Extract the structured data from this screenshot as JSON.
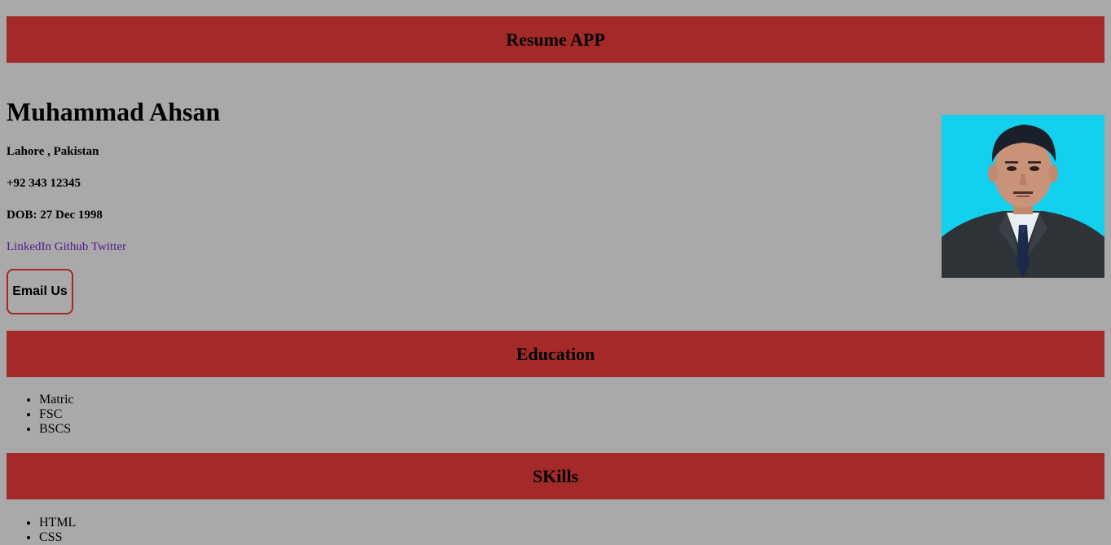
{
  "header": {
    "title": "Resume APP"
  },
  "profile": {
    "name": "Muhammad Ahsan",
    "location": "Lahore , Pakistan",
    "phone": "+92 343 12345",
    "dob": "DOB: 27 Dec 1998",
    "links": [
      "LinkedIn",
      "Github",
      "Twitter"
    ],
    "email_button": "Email Us",
    "photo_icon": "profile-photo"
  },
  "education": {
    "title": "Education",
    "items": [
      "Matric",
      "FSC",
      "BSCS"
    ]
  },
  "skills": {
    "title": "SKills",
    "items": [
      "HTML",
      "CSS"
    ]
  },
  "colors": {
    "background": "#a9a9a9",
    "banner": "#a42a2a",
    "link": "#551a8b"
  }
}
